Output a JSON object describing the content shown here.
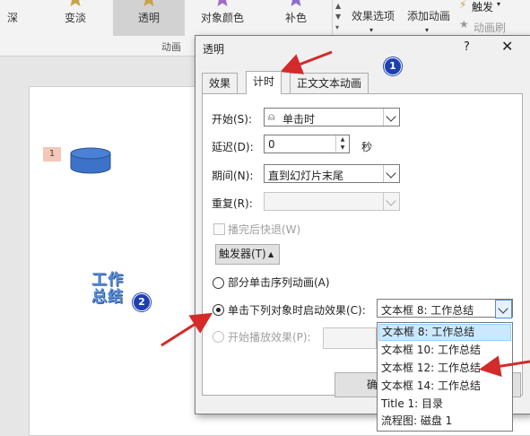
{
  "ribbon": {
    "items": [
      {
        "label": "深"
      },
      {
        "label": "变淡"
      },
      {
        "label": "透明"
      },
      {
        "label": "对象颜色"
      },
      {
        "label": "补色"
      }
    ],
    "effect_options": "效果选项",
    "add_animation": "添加动画",
    "trigger": "触发",
    "animation_painter": "动画刷",
    "section_label": "动画"
  },
  "slide": {
    "anim_tag": "1",
    "wordart_line1": "工作",
    "wordart_line2": "总结",
    "badge2": "2"
  },
  "dialog": {
    "title": "透明",
    "help": "?",
    "close": "✕",
    "badge1": "1",
    "tabs": [
      {
        "label": "效果"
      },
      {
        "label": "计时"
      },
      {
        "label": "正文文本动画"
      }
    ],
    "start_label": "开始(S):",
    "start_value": "单击时",
    "delay_label": "延迟(D):",
    "delay_value": "0",
    "delay_unit": "秒",
    "period_label": "期间(N):",
    "period_value": "直到幻灯片末尾",
    "repeat_label": "重复(R):",
    "rewind_label": "播完后快退(W)",
    "trigger_button": "触发器(T)",
    "option_sequence": "部分单击序列动画(A)",
    "option_click_object": "单击下列对象时启动效果(C):",
    "option_click_value": "文本框 8: 工作总结",
    "option_start_effect": "开始播放效果(P):",
    "ok": "确"
  },
  "dropdown": {
    "items": [
      "文本框 8: 工作总结",
      "文本框 10: 工作总结",
      "文本框 12: 工作总结",
      "文本框 14: 工作总结",
      "Title 1:  目录",
      "流程图: 磁盘 1"
    ],
    "selected_index": 0
  },
  "colors": {
    "arrow": "#d42a2a",
    "badge": "#1f3fb0",
    "selection": "#cce8ff"
  }
}
